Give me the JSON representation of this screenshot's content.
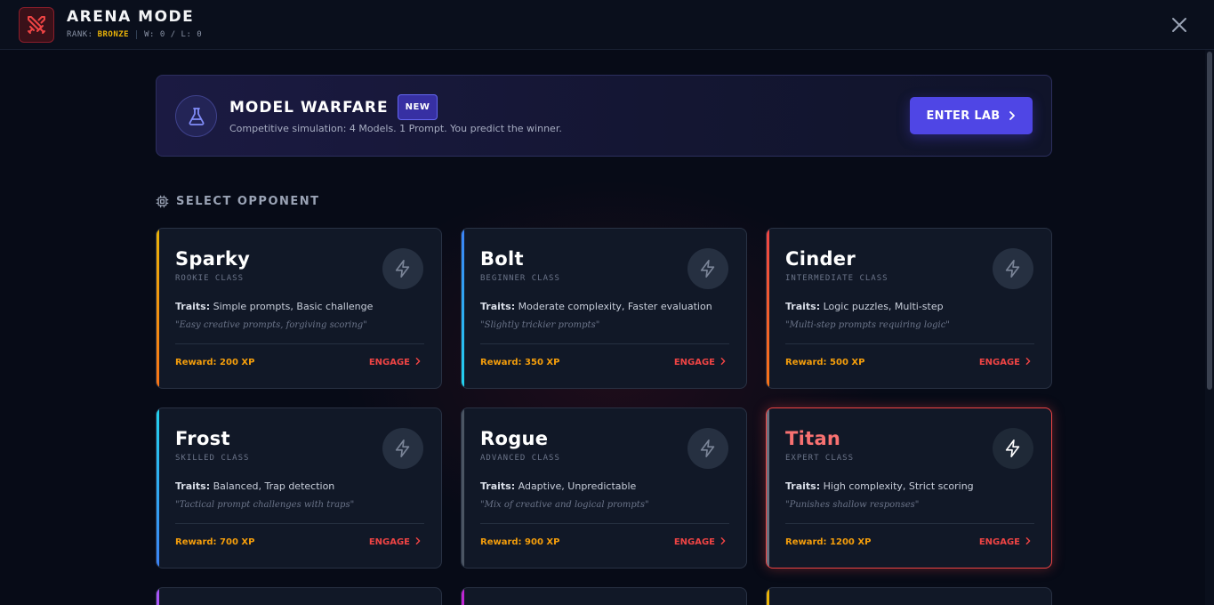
{
  "header": {
    "title": "ARENA MODE",
    "rank_label": "RANK:",
    "rank_value": "BRONZE",
    "record": "W: 0 / L: 0"
  },
  "banner": {
    "title": "MODEL WARFARE",
    "badge": "NEW",
    "subtitle": "Competitive simulation: 4 Models. 1 Prompt. You predict the winner.",
    "button_label": "ENTER LAB"
  },
  "section": {
    "heading": "SELECT OPPONENT"
  },
  "opponents": [
    {
      "name": "Sparky",
      "class": "ROOKIE CLASS",
      "traits_label": "Traits:",
      "traits": "Simple prompts, Basic challenge",
      "quote": "\"Easy creative prompts, forgiving scoring\"",
      "reward": "Reward: 200 XP",
      "engage": "ENGAGE",
      "accent": "#f59e0b"
    },
    {
      "name": "Bolt",
      "class": "BEGINNER CLASS",
      "traits_label": "Traits:",
      "traits": "Moderate complexity, Faster evaluation",
      "quote": "\"Slightly trickier prompts\"",
      "reward": "Reward: 350 XP",
      "engage": "ENGAGE",
      "accent": "#3b82f6"
    },
    {
      "name": "Cinder",
      "class": "INTERMEDIATE CLASS",
      "traits_label": "Traits:",
      "traits": "Logic puzzles, Multi-step",
      "quote": "\"Multi-step prompts requiring logic\"",
      "reward": "Reward: 500 XP",
      "engage": "ENGAGE",
      "accent": "#ef4444"
    },
    {
      "name": "Frost",
      "class": "SKILLED CLASS",
      "traits_label": "Traits:",
      "traits": "Balanced, Trap detection",
      "quote": "\"Tactical prompt challenges with traps\"",
      "reward": "Reward: 700 XP",
      "engage": "ENGAGE",
      "accent": "#22d3ee"
    },
    {
      "name": "Rogue",
      "class": "ADVANCED CLASS",
      "traits_label": "Traits:",
      "traits": "Adaptive, Unpredictable",
      "quote": "\"Mix of creative and logical prompts\"",
      "reward": "Reward: 900 XP",
      "engage": "ENGAGE",
      "accent": "#4b5563"
    },
    {
      "name": "Titan",
      "class": "EXPERT CLASS",
      "traits_label": "Traits:",
      "traits": "High complexity, Strict scoring",
      "quote": "\"Punishes shallow responses\"",
      "reward": "Reward: 1200 XP",
      "engage": "ENGAGE",
      "accent": "#6b7280"
    }
  ],
  "colors": {
    "background": "#070b17",
    "rank_gold": "#eab308",
    "reward_orange": "#f59e0b",
    "engage_red": "#ef4444",
    "button_indigo": "#4f46e5",
    "highlight_border": "#ef4444"
  },
  "icons": {
    "logo": "crossed-swords-icon",
    "close": "close-icon",
    "banner": "flask-icon",
    "section": "cpu-chip-icon",
    "card": "lightning-bolt-icon",
    "chevron": "chevron-right-icon"
  }
}
